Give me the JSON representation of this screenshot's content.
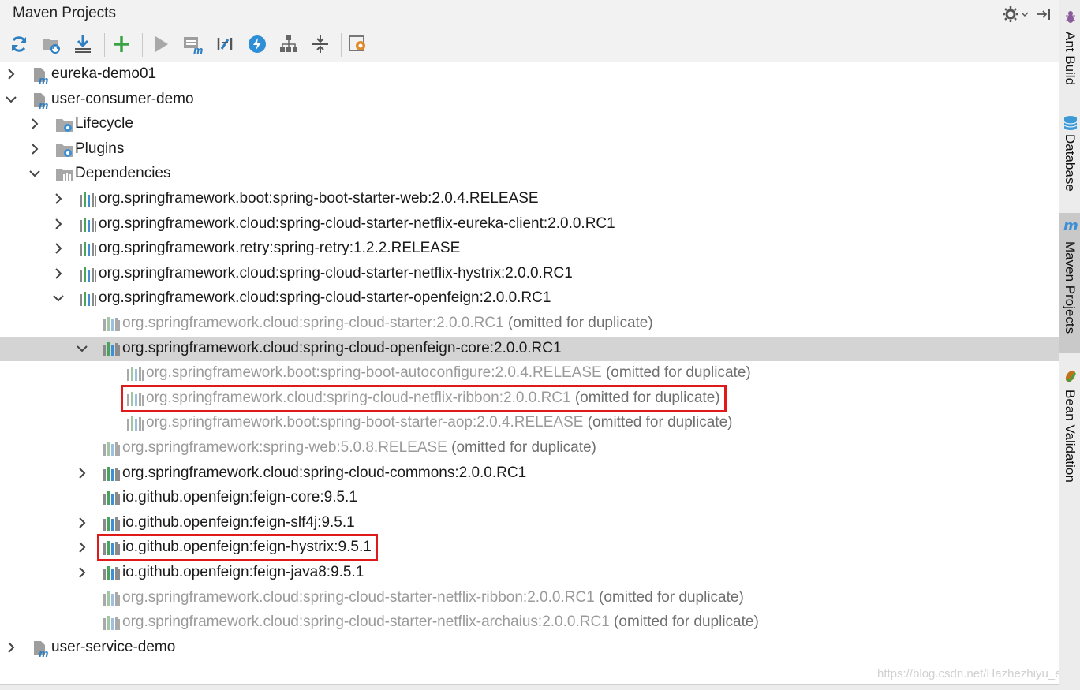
{
  "window": {
    "title": "Maven Projects"
  },
  "toolbar": {
    "buttons": [
      {
        "name": "reimport-icon"
      },
      {
        "name": "generate-sources-icon"
      },
      {
        "name": "download-icon"
      },
      {
        "name": "add-icon"
      },
      {
        "name": "run-icon"
      },
      {
        "name": "execute-goal-icon"
      },
      {
        "name": "toggle-offline-icon"
      },
      {
        "name": "skip-tests-icon"
      },
      {
        "name": "show-dependencies-icon"
      },
      {
        "name": "collapse-all-icon"
      },
      {
        "name": "settings-icon"
      }
    ]
  },
  "tree": {
    "rows": [
      {
        "label": "eureka-demo01",
        "omitted": false,
        "gray": false,
        "arrow": "right",
        "icon": "maven-module-icon"
      },
      {
        "label": "user-consumer-demo",
        "omitted": false,
        "gray": false,
        "arrow": "down",
        "icon": "maven-module-icon"
      },
      {
        "label": "Lifecycle",
        "omitted": false,
        "gray": false,
        "arrow": "right",
        "icon": "lifecycle-folder-icon"
      },
      {
        "label": "Plugins",
        "omitted": false,
        "gray": false,
        "arrow": "right",
        "icon": "plugins-folder-icon"
      },
      {
        "label": "Dependencies",
        "omitted": false,
        "gray": false,
        "arrow": "down",
        "icon": "dependencies-folder-icon"
      },
      {
        "label": "org.springframework.boot:spring-boot-starter-web:2.0.4.RELEASE",
        "gray": false,
        "arrow": "right",
        "icon": "library-icon"
      },
      {
        "label": "org.springframework.cloud:spring-cloud-starter-netflix-eureka-client:2.0.0.RC1",
        "gray": false,
        "arrow": "right",
        "icon": "library-icon"
      },
      {
        "label": "org.springframework.retry:spring-retry:1.2.2.RELEASE",
        "gray": false,
        "arrow": "right",
        "icon": "library-icon"
      },
      {
        "label": "org.springframework.cloud:spring-cloud-starter-netflix-hystrix:2.0.0.RC1",
        "gray": false,
        "arrow": "right",
        "icon": "library-icon"
      },
      {
        "label": "org.springframework.cloud:spring-cloud-starter-openfeign:2.0.0.RC1",
        "gray": false,
        "arrow": "down",
        "icon": "library-icon"
      },
      {
        "label": "org.springframework.cloud:spring-cloud-starter:2.0.0.RC1",
        "suffix": "(omitted for duplicate)",
        "gray": true,
        "arrow": "none",
        "icon": "library-icon"
      },
      {
        "label": "org.springframework.cloud:spring-cloud-openfeign-core:2.0.0.RC1",
        "gray": false,
        "arrow": "down",
        "icon": "library-icon",
        "selected": true
      },
      {
        "label": "org.springframework.boot:spring-boot-autoconfigure:2.0.4.RELEASE",
        "suffix": "(omitted for duplicate)",
        "gray": true,
        "arrow": "none",
        "icon": "library-icon"
      },
      {
        "label": "org.springframework.cloud:spring-cloud-netflix-ribbon:2.0.0.RC1",
        "suffix": "(omitted for duplicate)",
        "gray": true,
        "arrow": "none",
        "icon": "library-icon",
        "highlighted": true
      },
      {
        "label": "org.springframework.boot:spring-boot-starter-aop:2.0.4.RELEASE",
        "suffix": "(omitted for duplicate)",
        "gray": true,
        "arrow": "none",
        "icon": "library-icon"
      },
      {
        "label": "org.springframework:spring-web:5.0.8.RELEASE",
        "suffix": "(omitted for duplicate)",
        "gray": true,
        "arrow": "none",
        "icon": "library-icon"
      },
      {
        "label": "org.springframework.cloud:spring-cloud-commons:2.0.0.RC1",
        "gray": false,
        "arrow": "right",
        "icon": "library-icon"
      },
      {
        "label": "io.github.openfeign:feign-core:9.5.1",
        "gray": false,
        "arrow": "none",
        "icon": "library-icon"
      },
      {
        "label": "io.github.openfeign:feign-slf4j:9.5.1",
        "gray": false,
        "arrow": "right",
        "icon": "library-icon"
      },
      {
        "label": "io.github.openfeign:feign-hystrix:9.5.1",
        "gray": false,
        "arrow": "right",
        "icon": "library-icon",
        "highlighted": true
      },
      {
        "label": "io.github.openfeign:feign-java8:9.5.1",
        "gray": false,
        "arrow": "right",
        "icon": "library-icon"
      },
      {
        "label": "org.springframework.cloud:spring-cloud-starter-netflix-ribbon:2.0.0.RC1",
        "suffix": "(omitted for duplicate)",
        "gray": true,
        "arrow": "none",
        "icon": "library-icon"
      },
      {
        "label": "org.springframework.cloud:spring-cloud-starter-netflix-archaius:2.0.0.RC1",
        "suffix": "(omitted for duplicate)",
        "gray": true,
        "arrow": "none",
        "icon": "library-icon"
      },
      {
        "label": "user-service-demo",
        "gray": false,
        "arrow": "right",
        "icon": "maven-module-icon"
      }
    ]
  },
  "side_tabs": [
    {
      "label": "Ant Build",
      "icon": "ant-icon"
    },
    {
      "label": "Database",
      "icon": "database-icon"
    },
    {
      "label": "Maven Projects",
      "icon": "maven-icon",
      "active": true
    },
    {
      "label": "Bean Validation",
      "icon": "bean-validation-icon"
    }
  ],
  "watermark": "https://blog.csdn.net/Hazhezhiyu_e",
  "colors": {
    "selection": "#d4d4d4",
    "highlight_border": "#e01a1a",
    "omitted_text": "#9a9a9a"
  }
}
